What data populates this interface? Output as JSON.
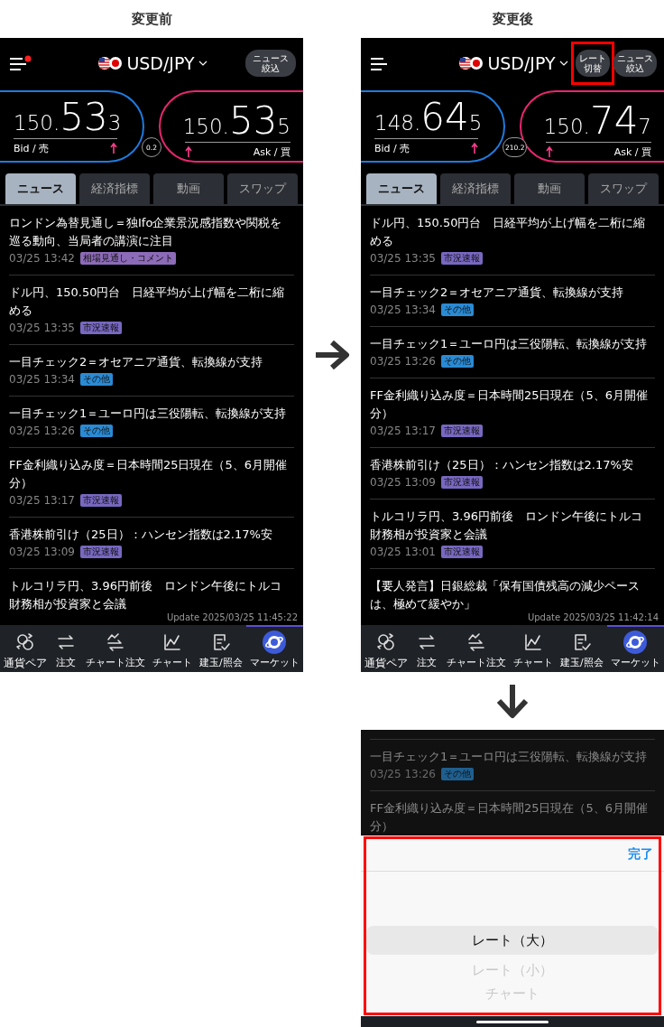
{
  "screens": [
    {
      "caption": "変更前",
      "header": {
        "menu_notification": true,
        "pair": "USD/JPY",
        "buttons": [
          {
            "lines": [
              "ニュース",
              "絞込"
            ],
            "annotated": false
          }
        ]
      },
      "bid": {
        "head": "150.",
        "big": "53",
        "tail": "3",
        "label": "Bid / 売",
        "rising": true
      },
      "spread": "0.2",
      "ask": {
        "head": "150.",
        "big": "53",
        "tail": "5",
        "label": "Ask / 買",
        "rising": true
      },
      "tabs": [
        {
          "label": "ニュース",
          "selected": true
        },
        {
          "label": "経済指標",
          "selected": false
        },
        {
          "label": "動画",
          "selected": false
        },
        {
          "label": "スワップ",
          "selected": false
        }
      ],
      "news": [
        {
          "title": "ロンドン為替見通し＝独Ifo企業景況感指数や関税を巡る動向、当局者の講演に注目",
          "date": "03/25 13:42",
          "tag": "相場見通し・コメント",
          "color": "#8c6bb8"
        },
        {
          "title": "ドル円、150.50円台　日経平均が上げ幅を二桁に縮める",
          "date": "03/25 13:35",
          "tag": "市況速報",
          "color": "#7868c0"
        },
        {
          "title": "一目チェック2＝オセアニア通貨、転換線が支持",
          "date": "03/25 13:34",
          "tag": "その他",
          "color": "#2a8ad4"
        },
        {
          "title": "一目チェック1＝ユーロ円は三役陽転、転換線が支持",
          "date": "03/25 13:26",
          "tag": "その他",
          "color": "#2a8ad4"
        },
        {
          "title": "FF金利織り込み度＝日本時間25日現在（5、6月開催分）",
          "date": "03/25 13:17",
          "tag": "市況速報",
          "color": "#7868c0"
        },
        {
          "title": "香港株前引け（25日）：ハンセン指数は2.17%安",
          "date": "03/25 13:09",
          "tag": "市況速報",
          "color": "#7868c0"
        },
        {
          "title": "トルコリラ円、3.96円前後　ロンドン午後にトルコ財務相が投資家と会議"
        }
      ],
      "update": "Update 2025/03/25 11:45:22",
      "nav": [
        {
          "label": "通貨ペア",
          "selected": false
        },
        {
          "label": "注文",
          "selected": false
        },
        {
          "label": "チャート注文",
          "selected": false
        },
        {
          "label": "チャート",
          "selected": false
        },
        {
          "label": "建玉/照会",
          "selected": false
        },
        {
          "label": "マーケット",
          "selected": true
        }
      ]
    },
    {
      "caption": "変更後",
      "header": {
        "menu_notification": false,
        "pair": "USD/JPY",
        "buttons": [
          {
            "lines": [
              "レート",
              "切替"
            ],
            "annotated": true
          },
          {
            "lines": [
              "ニュース",
              "絞込"
            ],
            "annotated": false
          }
        ]
      },
      "bid": {
        "head": "148.",
        "big": "64",
        "tail": "5",
        "label": "Bid / 売",
        "rising": true
      },
      "spread": "210.2",
      "ask": {
        "head": "150.",
        "big": "74",
        "tail": "7",
        "label": "Ask / 買",
        "rising": true
      },
      "tabs": [
        {
          "label": "ニュース",
          "selected": true
        },
        {
          "label": "経済指標",
          "selected": false
        },
        {
          "label": "動画",
          "selected": false
        },
        {
          "label": "スワップ",
          "selected": false
        }
      ],
      "news": [
        {
          "title": "ドル円、150.50円台　日経平均が上げ幅を二桁に縮める",
          "date": "03/25 13:35",
          "tag": "市況速報",
          "color": "#7868c0"
        },
        {
          "title": "一目チェック2＝オセアニア通貨、転換線が支持",
          "date": "03/25 13:34",
          "tag": "その他",
          "color": "#2a8ad4"
        },
        {
          "title": "一目チェック1＝ユーロ円は三役陽転、転換線が支持",
          "date": "03/25 13:26",
          "tag": "その他",
          "color": "#2a8ad4"
        },
        {
          "title": "FF金利織り込み度＝日本時間25日現在（5、6月開催分）",
          "date": "03/25 13:17",
          "tag": "市況速報",
          "color": "#7868c0"
        },
        {
          "title": "香港株前引け（25日）：ハンセン指数は2.17%安",
          "date": "03/25 13:09",
          "tag": "市況速報",
          "color": "#7868c0"
        },
        {
          "title": "トルコリラ円、3.96円前後　ロンドン午後にトルコ財務相が投資家と会議",
          "date": "03/25 13:01",
          "tag": "市況速報",
          "color": "#7868c0"
        },
        {
          "title": "【要人発言】日銀総裁「保有国債残高の減少ペースは、極めて緩やか」"
        }
      ],
      "update": "Update 2025/03/25 11:42:14",
      "nav": [
        {
          "label": "通貨ペア",
          "selected": false
        },
        {
          "label": "注文",
          "selected": false
        },
        {
          "label": "チャート注文",
          "selected": false
        },
        {
          "label": "チャート",
          "selected": false
        },
        {
          "label": "建玉/照会",
          "selected": false
        },
        {
          "label": "マーケット",
          "selected": true
        }
      ]
    }
  ],
  "picker_screen": {
    "news": [
      {
        "title": "一目チェック1＝ユーロ円は三役陽転、転換線が支持",
        "date": "03/25 13:26",
        "tag": "その他",
        "color": "#1f5f8f"
      },
      {
        "title": "FF金利織り込み度＝日本時間25日現在（5、6月開催分）"
      }
    ],
    "sheet": {
      "annotated": true,
      "done": "完了",
      "options": [
        {
          "label": "レート（大）",
          "selected": true
        },
        {
          "label": "レート（小）",
          "selected": false
        },
        {
          "label": "チャート",
          "selected": false
        }
      ]
    }
  }
}
